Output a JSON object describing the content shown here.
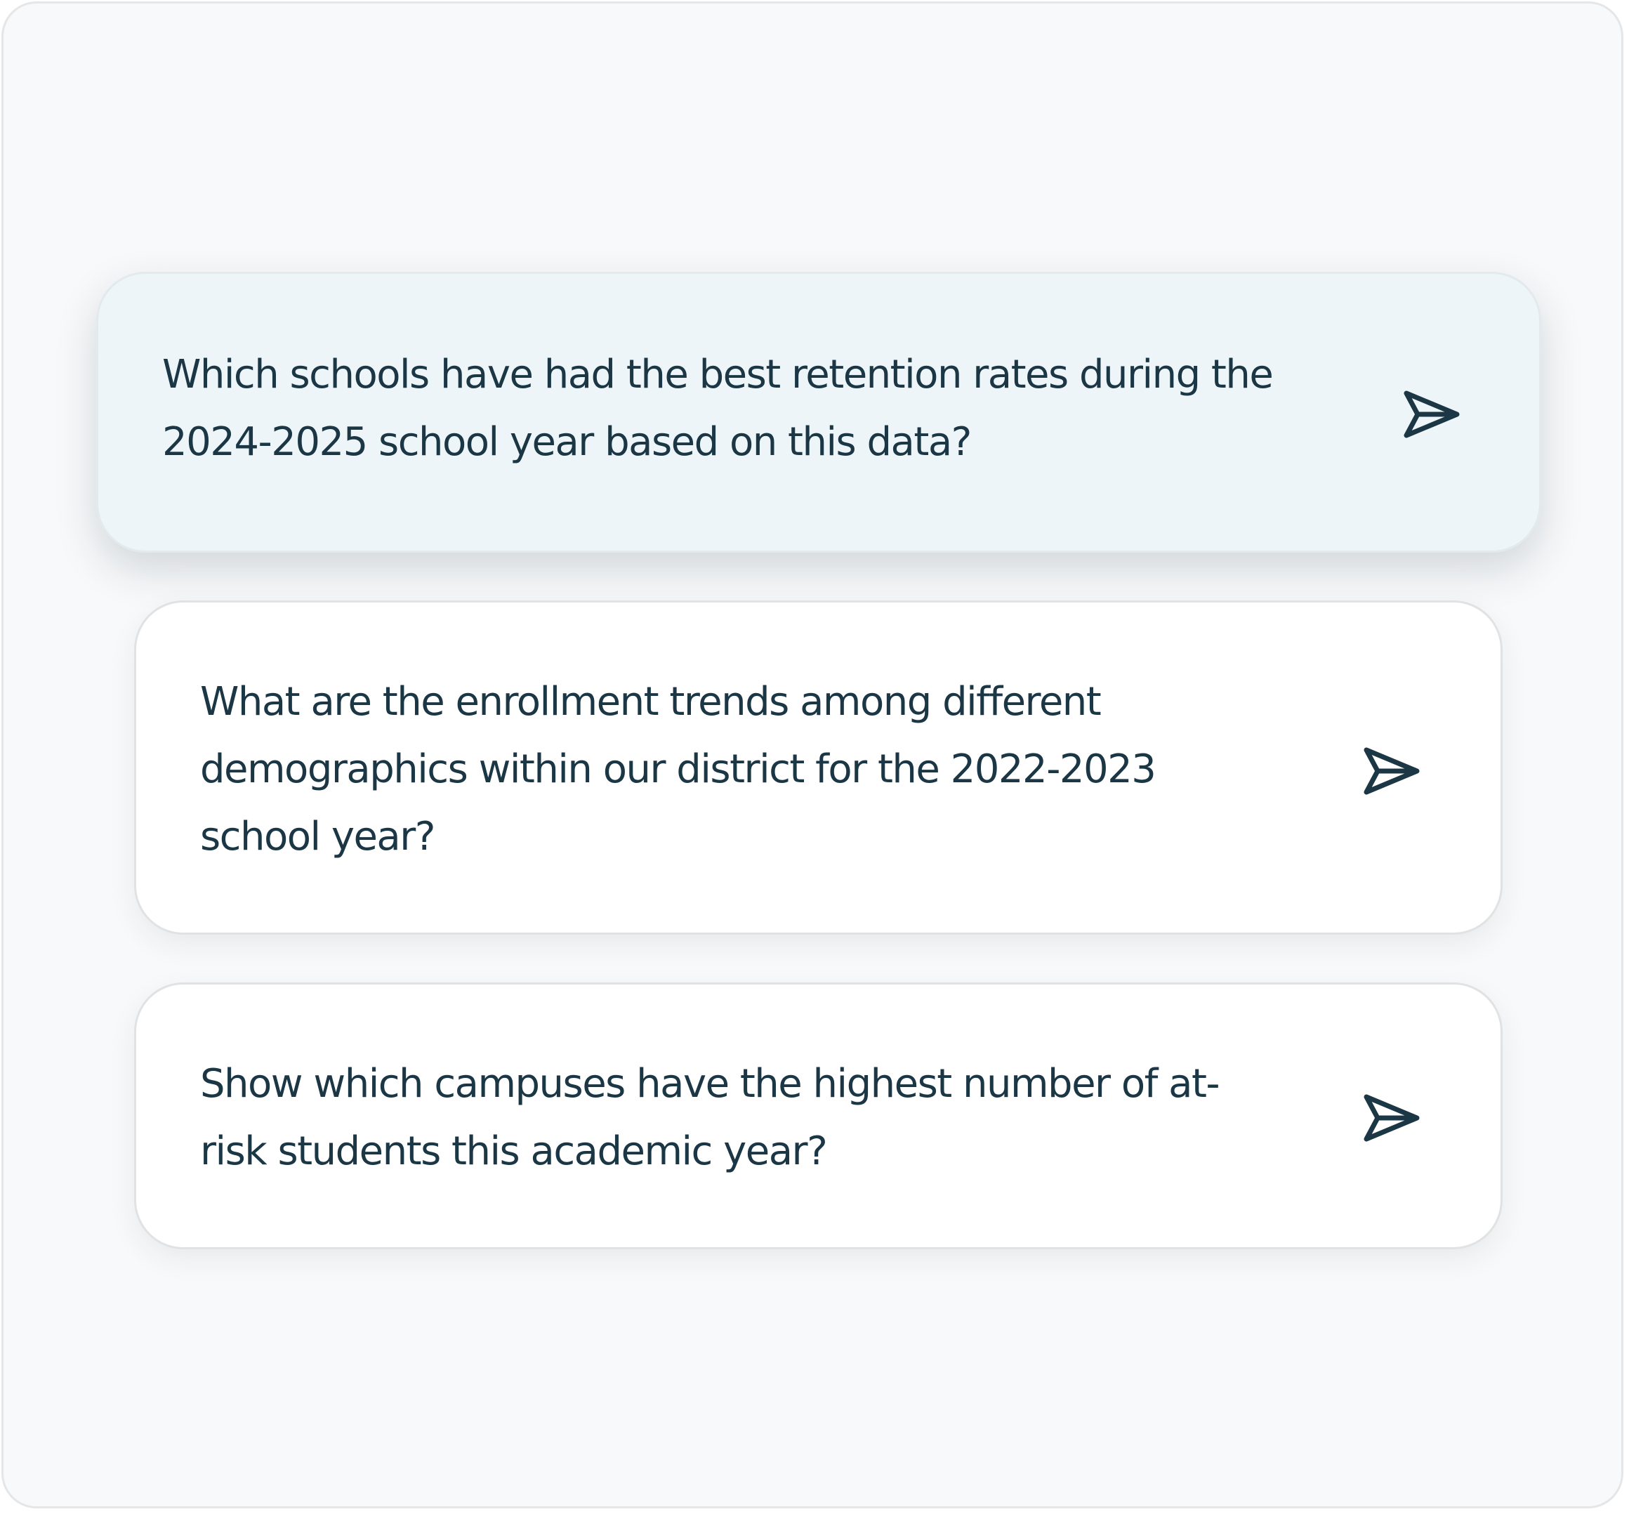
{
  "accent_color": "#1b3644",
  "suggestions": [
    {
      "lines": [
        "Which schools have had the best retention rates during the",
        "2024-2025 school year based on this data?"
      ],
      "icon": "send-icon",
      "state": "hovered"
    },
    {
      "lines": [
        "What are the enrollment trends among different",
        "demographics within our district for the 2022-2023",
        "school year?"
      ],
      "icon": "send-icon",
      "state": "default"
    },
    {
      "lines": [
        "Show which campuses have the highest number of at-",
        "risk students this academic year?"
      ],
      "icon": "send-icon",
      "state": "default"
    }
  ]
}
